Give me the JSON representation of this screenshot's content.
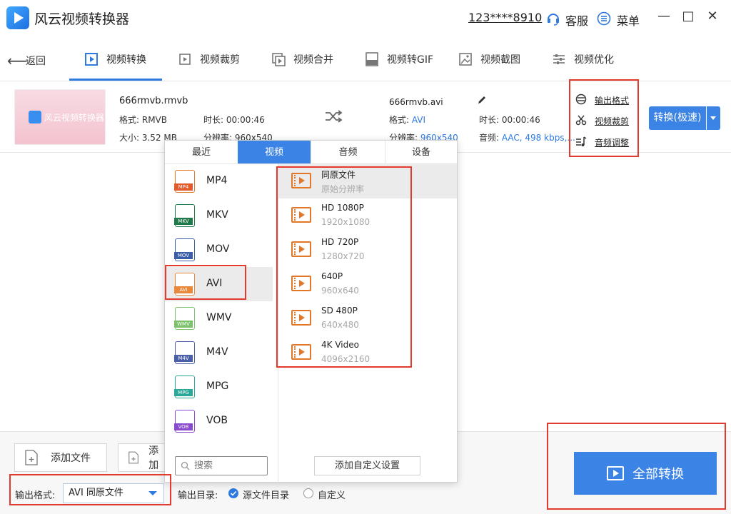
{
  "app": {
    "title": "风云视频转换器",
    "phone": "123****8910",
    "support": "客服",
    "menu": "菜单",
    "min": "—",
    "max": "□",
    "close": "✕"
  },
  "nav": {
    "back": "返回",
    "tabs": [
      {
        "label": "视频转换",
        "icon": "video-convert-icon",
        "active": true
      },
      {
        "label": "视频裁剪",
        "icon": "video-crop-icon"
      },
      {
        "label": "视频合并",
        "icon": "video-merge-icon"
      },
      {
        "label": "视频转GIF",
        "icon": "gif-icon"
      },
      {
        "label": "视频截图",
        "icon": "screenshot-icon"
      },
      {
        "label": "视频优化",
        "icon": "optimize-icon"
      }
    ]
  },
  "source": {
    "name": "666rmvb.rmvb",
    "format_label": "格式: ",
    "format": "RMVB",
    "duration_label": "时长: ",
    "duration": "00:00:46",
    "size_label": "大小: ",
    "size": "3.52 MB",
    "resolution_label": "分辨率: ",
    "resolution": "960x540",
    "thumb_text": "风云视频转换器"
  },
  "output": {
    "name": "666rmvb.avi",
    "format_label": "格式: ",
    "format": "AVI",
    "resolution_label": "分辨率: ",
    "resolution": "960x540",
    "duration_label": "时长: ",
    "duration": "00:00:46",
    "audio_label": "音频: ",
    "audio": "AAC, 498 kbps,..."
  },
  "options": {
    "output_format": "输出格式",
    "video_crop": "视频裁剪",
    "audio_adjust": "音频调整"
  },
  "convert_button": "转换(极速)",
  "popup": {
    "tabs": [
      "最近",
      "视频",
      "音频",
      "设备"
    ],
    "active_tab": 1,
    "formats": [
      {
        "name": "MP4",
        "tag": "MP4",
        "color": "#e25b2a"
      },
      {
        "name": "MKV",
        "tag": "MKV",
        "color": "#1f7a4a"
      },
      {
        "name": "MOV",
        "tag": "MOV",
        "color": "#3a5fa8"
      },
      {
        "name": "AVI",
        "tag": "AVI",
        "color": "#e8883a"
      },
      {
        "name": "WMV",
        "tag": "WMV",
        "color": "#7cc26a"
      },
      {
        "name": "M4V",
        "tag": "M4V",
        "color": "#4a5fa8"
      },
      {
        "name": "MPG",
        "tag": "MPG",
        "color": "#2aa89a"
      },
      {
        "name": "VOB",
        "tag": "VOB",
        "color": "#8a4ad0"
      }
    ],
    "selected_format": 3,
    "resolutions": [
      {
        "name": "同原文件",
        "sub": "原始分辨率"
      },
      {
        "name": "HD 1080P",
        "sub": "1920x1080"
      },
      {
        "name": "HD 720P",
        "sub": "1280x720"
      },
      {
        "name": "640P",
        "sub": "960x640"
      },
      {
        "name": "SD 480P",
        "sub": "640x480"
      },
      {
        "name": "4K Video",
        "sub": "4096x2160"
      }
    ],
    "search_placeholder": "搜索",
    "custom_button": "添加自定义设置"
  },
  "bottom": {
    "add_file": "添加文件",
    "add_folder": "添加",
    "output_format_label": "输出格式:",
    "output_format_value": "AVI 同原文件",
    "output_dir_label": "输出目录:",
    "dir_source": "源文件目录",
    "dir_custom": "自定义",
    "convert_all": "全部转换"
  }
}
